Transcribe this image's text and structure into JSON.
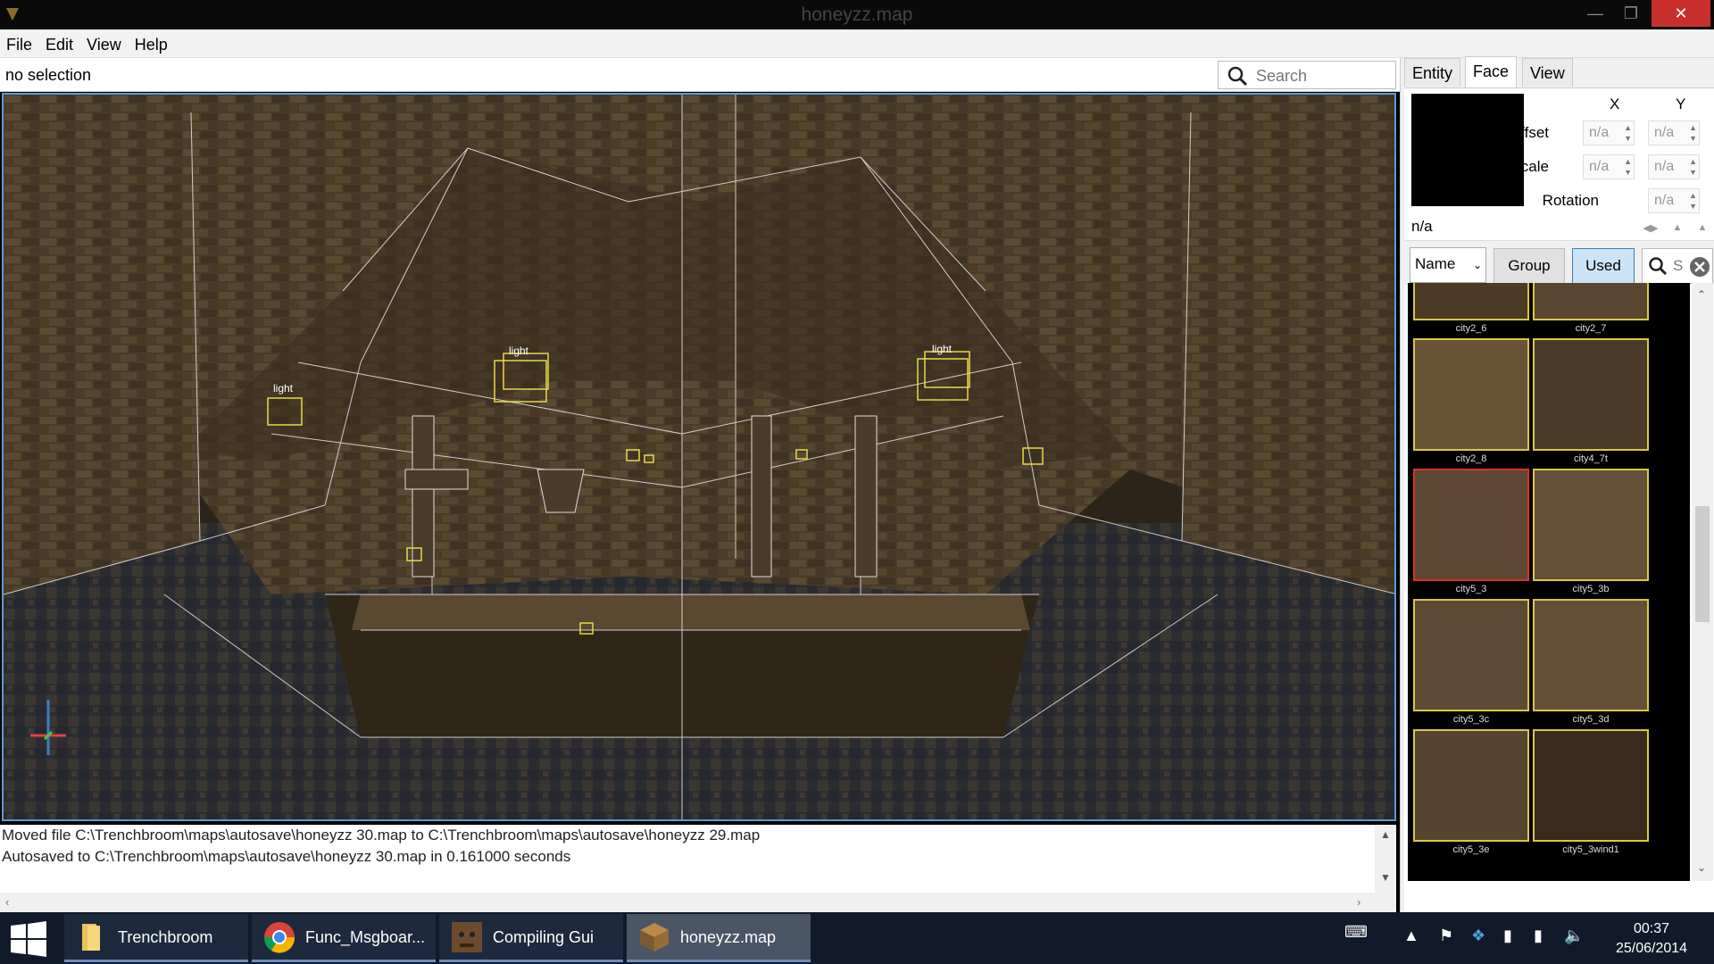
{
  "window": {
    "title": "honeyzz.map"
  },
  "menu": [
    "File",
    "Edit",
    "View",
    "Help"
  ],
  "selection": {
    "text": "no selection"
  },
  "search": {
    "placeholder": "Search"
  },
  "viewport": {
    "light_label": "light"
  },
  "console": {
    "lines": [
      "Moved file C:\\Trenchbroom\\maps\\autosave\\honeyzz 30.map to C:\\Trenchbroom\\maps\\autosave\\honeyzz 29.map",
      "Autosaved to C:\\Trenchbroom\\maps\\autosave\\honeyzz 30.map in 0.161000 seconds"
    ]
  },
  "inspector": {
    "tabs": [
      {
        "label": "Entity",
        "active": false
      },
      {
        "label": "Face",
        "active": true
      },
      {
        "label": "View",
        "active": false
      }
    ],
    "face": {
      "col_x": "X",
      "col_y": "Y",
      "offset_label": "Offset",
      "scale_label": "Scale",
      "rotation_label": "Rotation",
      "na": "n/a",
      "texture_name": "n/a"
    },
    "browser": {
      "sort": "Name",
      "group_label": "Group",
      "used_label": "Used",
      "search_placeholder": "S",
      "textures": [
        {
          "name": "city2_6",
          "color": "#4d3b26"
        },
        {
          "name": "city2_7",
          "color": "#5a4630"
        },
        {
          "name": "city2_8",
          "color": "#6a5236"
        },
        {
          "name": "city4_7t",
          "color": "#4b3a28"
        },
        {
          "name": "city5_3",
          "color": "#5e4733",
          "selected": true
        },
        {
          "name": "city5_3b",
          "color": "#66503a"
        },
        {
          "name": "city5_3c",
          "color": "#5e4a34"
        },
        {
          "name": "city5_3d",
          "color": "#654f38"
        },
        {
          "name": "city5_3e",
          "color": "#564330"
        },
        {
          "name": "city5_3wind1",
          "color": "#3a2a1c"
        }
      ]
    }
  },
  "taskbar": {
    "items": [
      {
        "label": "Trenchbroom",
        "icon": "folder-icon"
      },
      {
        "label": "Func_Msgboar...",
        "icon": "chrome-icon"
      },
      {
        "label": "Compiling Gui",
        "icon": "app-icon"
      },
      {
        "label": "honeyzz.map",
        "icon": "trenchbroom-icon",
        "active": true
      }
    ],
    "time": "00:37",
    "date": "25/06/2014"
  }
}
